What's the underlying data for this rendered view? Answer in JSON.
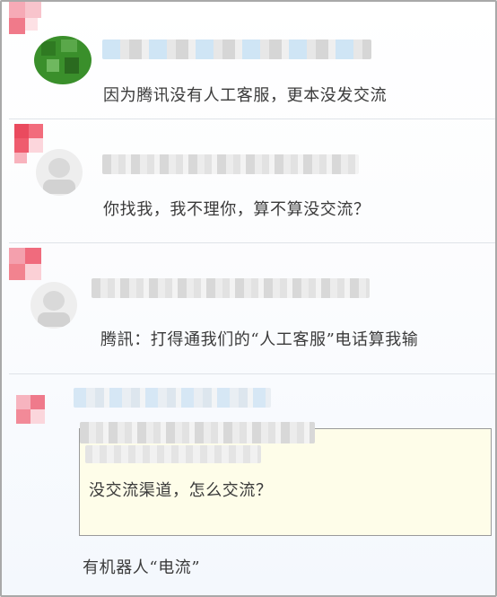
{
  "posts": [
    {
      "text": "因为腾讯没有人工客服，更本没发交流"
    },
    {
      "text": "你找我，我不理你，算不算没交流？"
    },
    {
      "text": "腾訊：打得通我们的“人工客服”电话算我输"
    }
  ],
  "quote": {
    "text": "没交流渠道，怎么交流？"
  },
  "reply": {
    "text": "有机器人“电流”"
  }
}
